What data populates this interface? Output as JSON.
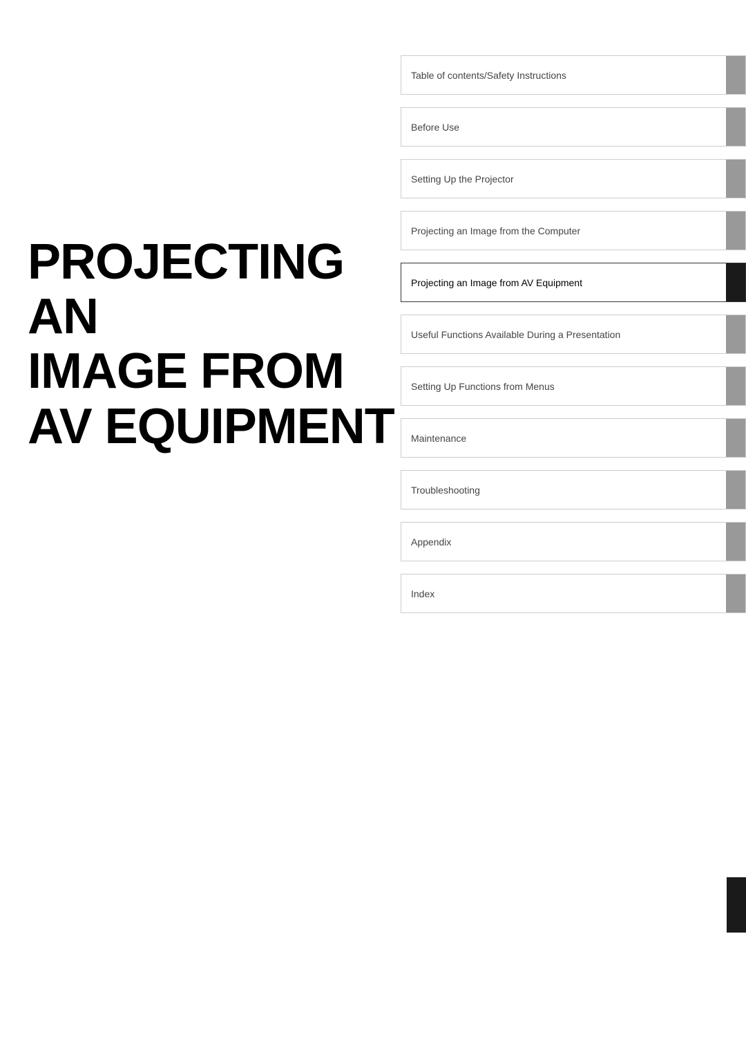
{
  "mainTitle": {
    "line1": "PROJECTING AN",
    "line2": "IMAGE FROM",
    "line3": "AV EQUIPMENT"
  },
  "navItems": [
    {
      "id": "toc",
      "label": "Table of contents/Safety Instructions",
      "active": false
    },
    {
      "id": "before-use",
      "label": "Before Use",
      "active": false
    },
    {
      "id": "setting-up-projector",
      "label": "Setting Up the Projector",
      "active": false
    },
    {
      "id": "projecting-computer",
      "label": "Projecting an Image from the Computer",
      "active": false
    },
    {
      "id": "projecting-av",
      "label": "Projecting an Image from AV Equipment",
      "active": true
    },
    {
      "id": "useful-functions",
      "label": "Useful Functions Available During a Presentation",
      "active": false
    },
    {
      "id": "setting-up-menus",
      "label": "Setting Up Functions from Menus",
      "active": false
    },
    {
      "id": "maintenance",
      "label": "Maintenance",
      "active": false
    },
    {
      "id": "troubleshooting",
      "label": "Troubleshooting",
      "active": false
    },
    {
      "id": "appendix",
      "label": "Appendix",
      "active": false
    },
    {
      "id": "index",
      "label": "Index",
      "active": false
    }
  ]
}
